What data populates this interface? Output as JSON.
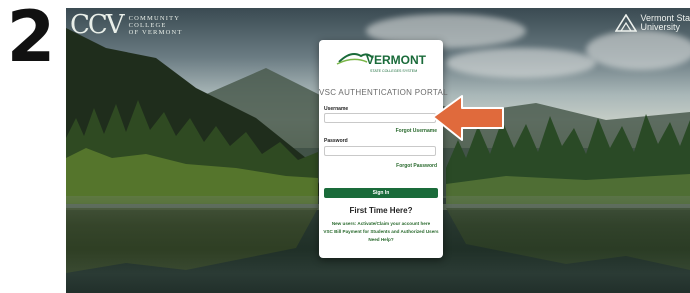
{
  "step_number": "2",
  "header_left": {
    "mark": "CCV",
    "lines": [
      "COMMUNITY",
      "COLLEGE",
      "OF VERMONT"
    ]
  },
  "header_right": {
    "lines": [
      "Vermont Sta",
      "University"
    ]
  },
  "login_card": {
    "logo_text": "VERMONT",
    "logo_subtext": "STATE COLLEGES SYSTEM",
    "portal_title": "VSC AUTHENTICATION PORTAL",
    "username_label": "Username",
    "username_value": "",
    "forgot_username": "Forgot Username",
    "password_label": "Password",
    "password_value": "",
    "forgot_password": "Forgot Password",
    "sign_in": "Sign In",
    "first_time_heading": "First Time Here?",
    "links": [
      "New users: Activate/Claim your account here",
      "VSC Bill Payment for Students and Authorized Users",
      "Need Help?"
    ]
  },
  "colors": {
    "brand_green": "#1a6b3a",
    "link_green": "#2a6a2e",
    "arrow_orange": "#e06a3c"
  },
  "icons": [
    "vermont-mountain-logo-icon",
    "ccv-logo-icon",
    "vsu-triangle-logo-icon",
    "pointer-arrow-icon"
  ]
}
